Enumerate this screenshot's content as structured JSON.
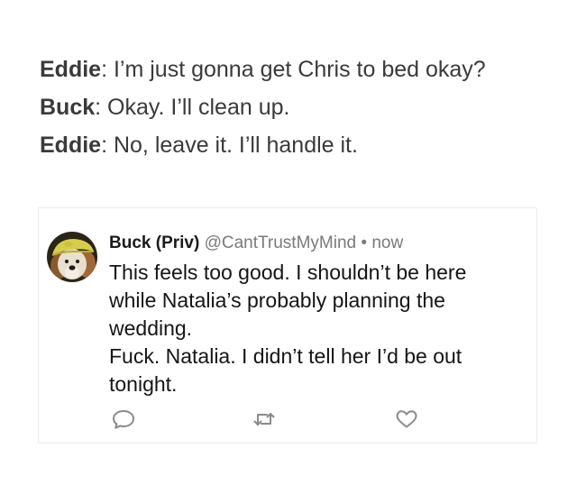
{
  "dialogue": [
    {
      "speaker": "Eddie",
      "separator": ":",
      "text": " I’m just gonna get Chris to bed okay?"
    },
    {
      "speaker": "Buck",
      "separator": ":",
      "text": " Okay. I’ll clean up."
    },
    {
      "speaker": "Eddie",
      "separator": ":",
      "text": " No, leave it. I’ll handle it."
    }
  ],
  "tweet": {
    "author_name": "Buck (Priv)",
    "handle": "@CantTrustMyMind",
    "dot": "•",
    "timestamp": "now",
    "body_lines": [
      "This feels too good. I shouldn’t be here",
      "while Natalia’s probably planning the",
      "wedding.",
      "Fuck. Natalia. I didn’t tell her I’d be out",
      "tonight."
    ],
    "avatar_icon": "dog-avatar",
    "actions": {
      "reply_icon": "reply-icon",
      "retweet_icon": "retweet-icon",
      "like_icon": "heart-icon"
    }
  },
  "colors": {
    "dialogue_text": "#3a3a3a",
    "tweet_text": "#151515",
    "muted": "#7a7a7a",
    "border": "#ececec"
  }
}
